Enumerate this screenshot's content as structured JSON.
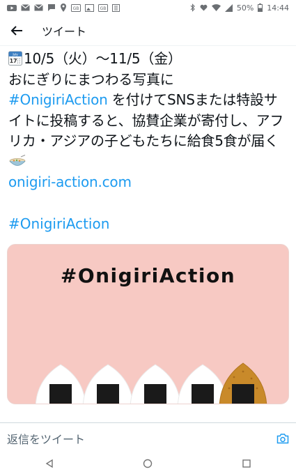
{
  "status_bar": {
    "battery": "50%",
    "time": "14:44",
    "left_icons": [
      "youtube-icon",
      "mail-icon",
      "mail-icon",
      "chat-icon",
      "location-icon",
      "photo-icon",
      "gallery-icon",
      "gallery-icon",
      "calendar-icon"
    ],
    "right_icons": [
      "bluetooth-icon",
      "heart-icon",
      "wifi-icon",
      "signal-icon",
      "battery-icon"
    ]
  },
  "app_bar": {
    "back_icon": "back-arrow-icon",
    "title": "ツイート"
  },
  "tweet": {
    "calendar_icon": "calendar-emoji-icon",
    "calendar_month": "July",
    "calendar_day": "17",
    "line_date": "10/5（火）〜11/5（金）",
    "line_intro": "おにぎりにまつわる写真に",
    "hashtag": "#OnigiriAction",
    "body_after_hashtag": " を付けてSNSまたは特設サイトに投稿すると、協賛企業が寄付し、アフリカ・アジアの子どもたちに給食5食が届く",
    "bowl_icon": "food-bowl-emoji-icon",
    "link": "onigiri-action.com",
    "hashtag_line": "#OnigiriAction"
  },
  "media": {
    "title": "#OnigiriAction",
    "background": "#f7c9c3",
    "onigiri_count": 5
  },
  "reply_bar": {
    "placeholder": "返信をツイート",
    "camera_icon": "camera-icon"
  },
  "nav_bar": {
    "icons": [
      "nav-back-icon",
      "nav-home-icon",
      "nav-recents-icon"
    ]
  },
  "colors": {
    "link": "#1d9bf0",
    "text": "#0f1419",
    "secondary": "#536471"
  }
}
